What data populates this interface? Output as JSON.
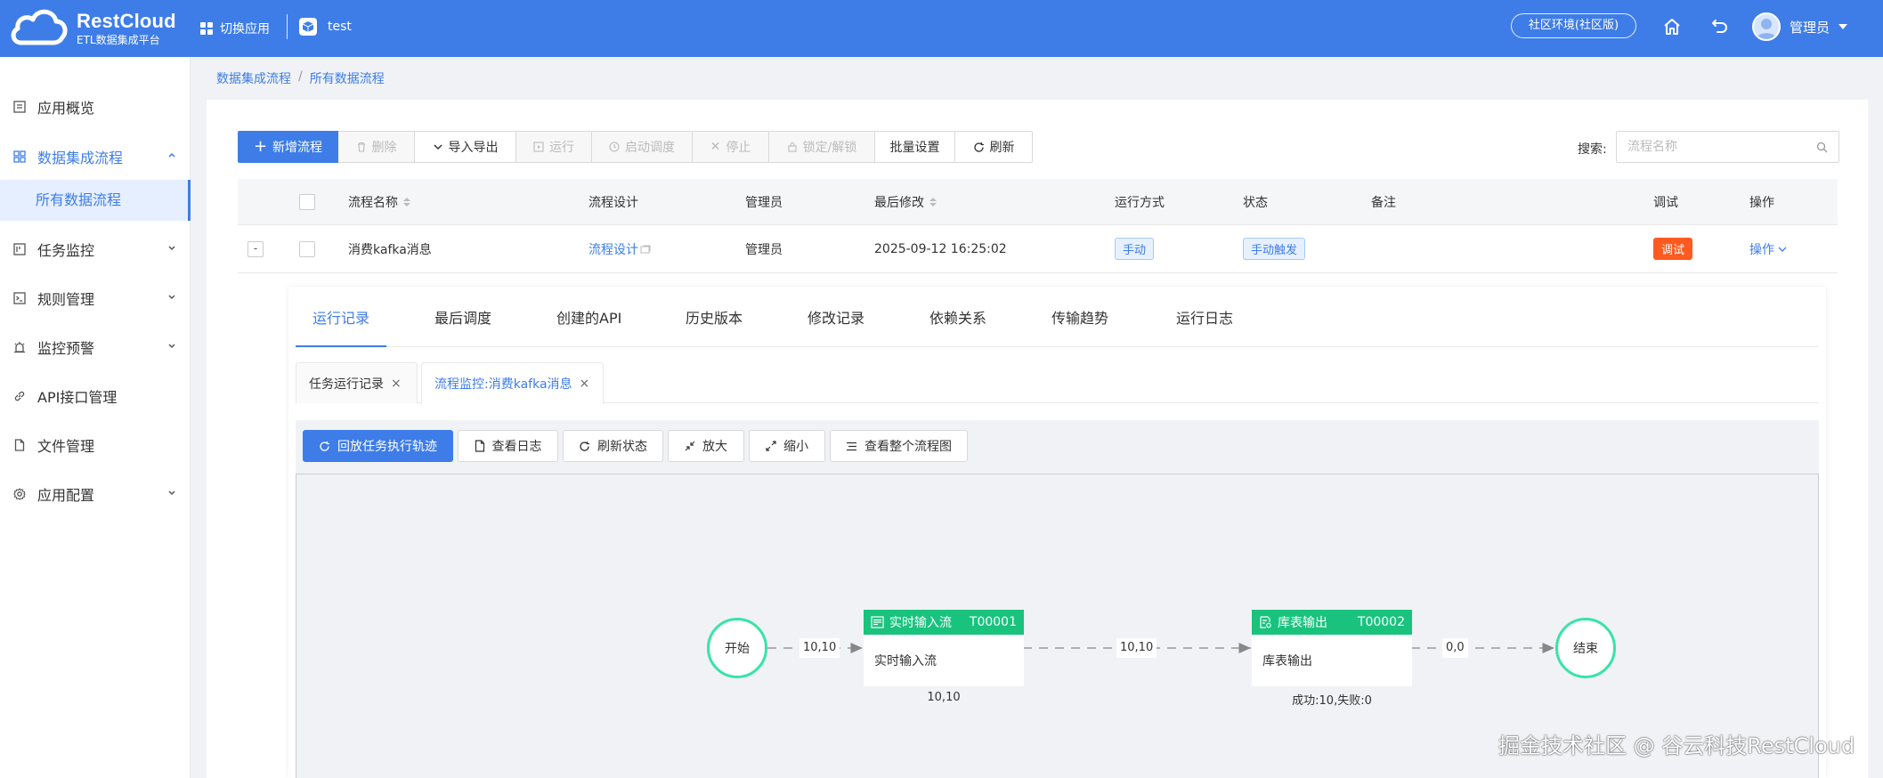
{
  "header": {
    "logo_title": "RestCloud",
    "logo_subtitle": "ETL数据集成平台",
    "switch_app": "切换应用",
    "app_name": "test",
    "env_badge": "社区环境(社区版)",
    "user_name": "管理员",
    "bg_color": "#3e7de8"
  },
  "sidebar": {
    "items": [
      {
        "label": "应用概览",
        "icon": "overview-icon"
      },
      {
        "label": "数据集成流程",
        "icon": "grid-icon",
        "expanded": true
      },
      {
        "label": "所有数据流程",
        "sub": true,
        "selected": true
      },
      {
        "label": "任务监控",
        "icon": "monitor-icon"
      },
      {
        "label": "规则管理",
        "icon": "terminal-icon"
      },
      {
        "label": "监控预警",
        "icon": "alarm-icon"
      },
      {
        "label": "API接口管理",
        "icon": "link-icon"
      },
      {
        "label": "文件管理",
        "icon": "file-icon"
      },
      {
        "label": "应用配置",
        "icon": "gear-icon"
      }
    ]
  },
  "breadcrumb": [
    "数据集成流程",
    "所有数据流程"
  ],
  "toolbar": {
    "buttons": [
      "新增流程",
      "删除",
      "导入导出",
      "运行",
      "启动调度",
      "停止",
      "锁定/解锁",
      "批量设置",
      "刷新"
    ]
  },
  "search": {
    "label": "搜索:",
    "placeholder": "流程名称"
  },
  "table": {
    "headers": [
      "流程名称",
      "流程设计",
      "管理员",
      "最后修改",
      "运行方式",
      "状态",
      "备注",
      "调试",
      "操作"
    ],
    "rows": [
      {
        "expand": "-",
        "name": "消费kafka消息",
        "design": "流程设计",
        "admin": "管理员",
        "modified": "2025-09-12 16:25:02",
        "run_mode": "手动",
        "status": "手动触发",
        "remark": "",
        "debug": "调试",
        "action": "操作"
      }
    ]
  },
  "panel": {
    "tabs": [
      "运行记录",
      "最后调度",
      "创建的API",
      "历史版本",
      "修改记录",
      "依赖关系",
      "传输趋势",
      "运行日志"
    ],
    "active_tab": "运行记录",
    "subtabs": [
      "任务运行记录",
      "流程监控:消费kafka消息"
    ],
    "flow_buttons": [
      "回放任务执行轨迹",
      "查看日志",
      "刷新状态",
      "放大",
      "缩小",
      "查看整个流程图"
    ]
  },
  "flow": {
    "start": "开始",
    "end": "结束",
    "nodes": [
      {
        "title": "实时输入流",
        "code": "T00001",
        "body": "实时输入流",
        "stat": "10,10"
      },
      {
        "title": "库表输出",
        "code": "T00002",
        "body": "库表输出",
        "stat": "成功:10,失败:0"
      }
    ],
    "edges": [
      "10,10",
      "10,10",
      "0,0"
    ],
    "node_color": "#19c37d",
    "circle_color": "#37e4a6"
  },
  "watermark": "掘金技术社区 @ 谷云科技RestCloud"
}
